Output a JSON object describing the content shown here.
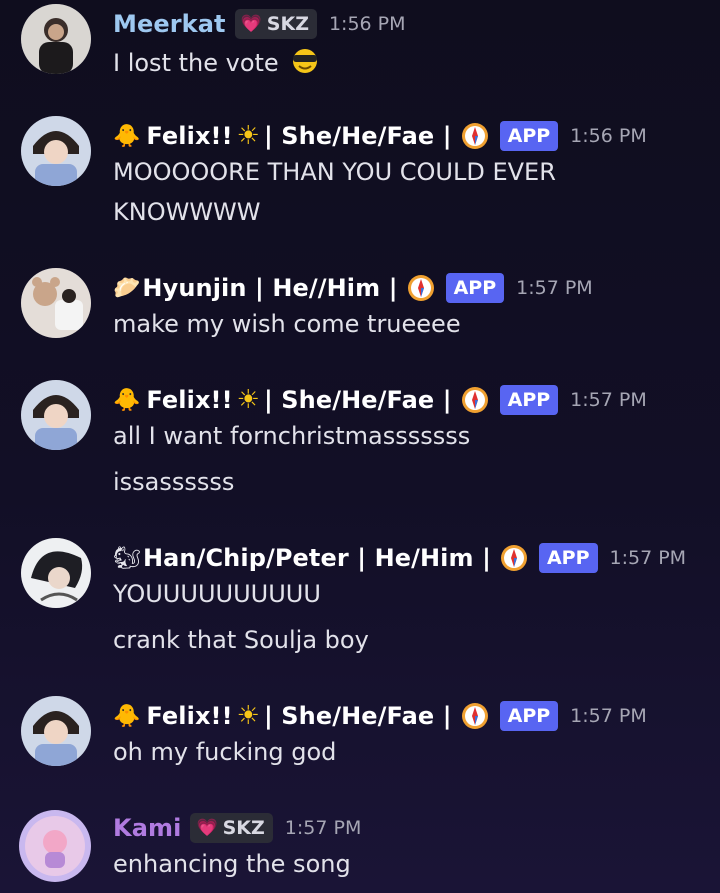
{
  "messages": [
    {
      "username": "Meerkat",
      "name_color": "#9ec8f0",
      "tag": "SKZ",
      "time": "1:56 PM",
      "lines": [
        "I lost the vote"
      ],
      "avatar_icon": "user-avatar-photo"
    },
    {
      "prefix_icon": "chick-emoji",
      "username": "Felix!!",
      "name_suffix": "| She/He/Fae |",
      "badge": "APP",
      "time": "1:56 PM",
      "lines": [
        "MOOOOORE THAN YOU COULD EVER",
        "KNOWWWW"
      ],
      "avatar_icon": "bot-avatar-photo"
    },
    {
      "prefix_icon": "dumpling-emoji",
      "username": "Hyunjin | He//Him |",
      "badge": "APP",
      "time": "1:57 PM",
      "lines": [
        "make my wish come trueeee"
      ],
      "avatar_icon": "bot-avatar-photo"
    },
    {
      "prefix_icon": "chick-emoji",
      "username": "Felix!!",
      "name_suffix": "| She/He/Fae |",
      "badge": "APP",
      "time": "1:57 PM",
      "lines": [
        "all I want fornchristmasssssss",
        "issassssss"
      ],
      "avatar_icon": "bot-avatar-photo"
    },
    {
      "prefix_icon": "chipmunk-emoji",
      "username": "Han/Chip/Peter | He/Him |",
      "badge": "APP",
      "time": "1:57 PM",
      "lines": [
        "YOUUUUUUUUUU",
        "crank that Soulja boy"
      ],
      "avatar_icon": "bot-avatar-photo"
    },
    {
      "prefix_icon": "chick-emoji",
      "username": "Felix!!",
      "name_suffix": "| She/He/Fae |",
      "badge": "APP",
      "time": "1:57 PM",
      "lines": [
        "oh my fucking god"
      ],
      "avatar_icon": "bot-avatar-photo"
    },
    {
      "username": "Kami",
      "name_color": "#b07be0",
      "tag": "SKZ",
      "time": "1:57 PM",
      "lines": [
        "enhancing the song"
      ],
      "avatar_icon": "user-avatar-photo"
    }
  ],
  "colors": {
    "app_badge": "#5865f2",
    "tag_bg": "#2b2c36",
    "timestamp": "#a6a6b4",
    "message_text": "#e2e2ea"
  }
}
